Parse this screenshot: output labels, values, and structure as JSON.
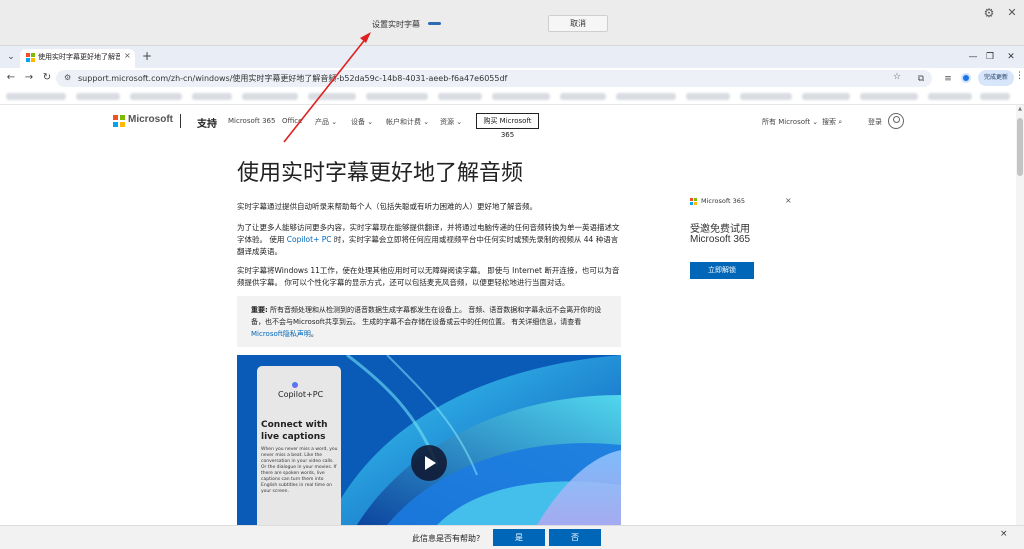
{
  "overlay": {
    "title": "设置实时字幕",
    "cancel_label": "取消",
    "settings_icon": "gear-icon",
    "close_icon": "close-icon"
  },
  "browser": {
    "tab_title": "使用实时字幕更好地了解音频",
    "tab_close": "×",
    "new_tab": "+",
    "url": "support.microsoft.com/zh-cn/windows/使用实时字幕更好地了解音频-b52da59c-14b8-4031-aeeb-f6a47e6055df",
    "update_label": "完成更新",
    "window_controls": {
      "minimize": "—",
      "restore": "❐",
      "close": "✕"
    },
    "nav": {
      "back": "←",
      "forward": "→",
      "reload": "↻"
    },
    "icons": {
      "site_info": "⚙",
      "star": "☆",
      "extensions": "⧉",
      "reading_list": "≡",
      "menu": "⋮",
      "tab_search": "⌄"
    }
  },
  "ms_header": {
    "brand": "Microsoft",
    "support": "支持",
    "nav": [
      {
        "label": "Microsoft 365"
      },
      {
        "label": "Office"
      },
      {
        "label": "产品 ⌄"
      },
      {
        "label": "设备 ⌄"
      },
      {
        "label": "帐户和计费 ⌄"
      },
      {
        "label": "资源 ⌄"
      }
    ],
    "buy_label": "购买 Microsoft 365",
    "all_ms": "所有 Microsoft ⌄",
    "search": "搜索 ⌕",
    "login": "登录"
  },
  "article": {
    "title": "使用实时字幕更好地了解音频",
    "p1": "实时字幕通过提供自动听录来帮助每个人（包括失聪或有听力困难的人）更好地了解音频。",
    "p2_part1": "为了让更多人能够访问更多内容，实时字幕现在能够提供翻译，并将通过电脑传递的任何音频转换为单一英语描述文字体验。 使用 ",
    "p2_link": "Copilot+ PC",
    "p2_part2": " 时，实时字幕会立即将任何应用或视频平台中任何实时或预先录制的视频从 44 种语言翻译成英语。",
    "p3": "实时字幕将Windows 11工作，使在处理其他应用时可以无障碍阅读字幕。 即使与 Internet 断开连接，也可以为音频提供字幕。 你可以个性化字幕的显示方式，还可以包括麦克风音频，以便更轻松地进行当面对话。",
    "notice_bold": "重要:",
    "notice_text": " 所有音频处理和从检测到的语音数据生成字幕都发生在设备上。 音频、语音数据和字幕永远不会离开你的设备，也不会与Microsoft共享到云。 生成的字幕不会存储在设备或云中的任何位置。 有关详细信息，请查看 ",
    "notice_link": "Microsoft隐私声明",
    "notice_end": "。"
  },
  "video": {
    "brand": "Copilot+PC",
    "heading": "Connect with live captions",
    "body": "When you never miss a word, you never miss a beat. Like the conversation in your video calls. Or the dialogue in your movies. If there are spoken words, live captions can turn them into English subtitles in real time on your screen."
  },
  "ad": {
    "brand": "Microsoft 365",
    "line1": "受邀免费试用",
    "line2": "Microsoft 365",
    "button": "立即解锁",
    "close": "×"
  },
  "feedback": {
    "question": "此信息是否有帮助?",
    "yes": "是",
    "no": "否",
    "close": "×"
  }
}
